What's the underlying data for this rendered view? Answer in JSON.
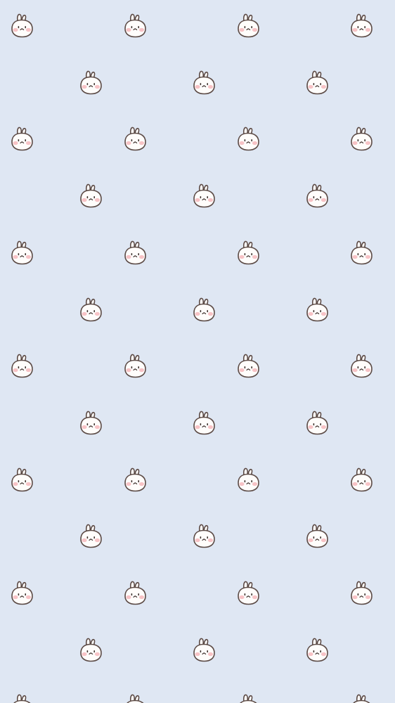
{
  "background_color": "#dfe7f3",
  "pattern_icon": "bunny-face-icon",
  "bunny_colors": {
    "fill": "#fffdfb",
    "outline": "#5b4a45",
    "blush": "#f7c3c6",
    "face": "#3d302c"
  }
}
